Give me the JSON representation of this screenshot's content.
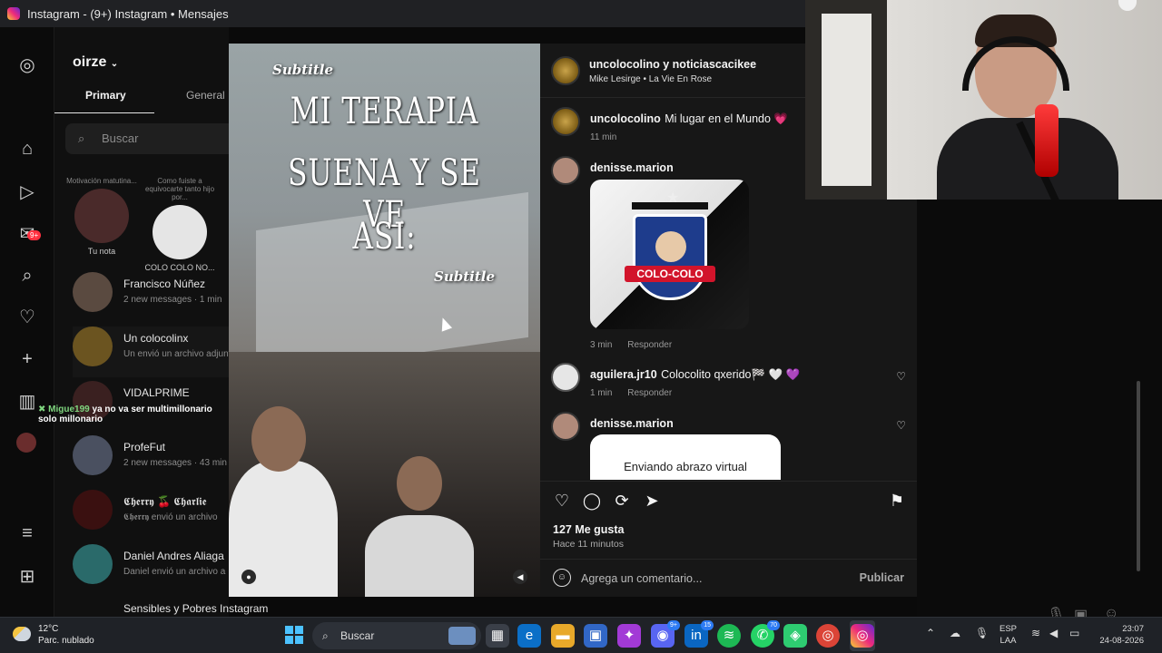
{
  "window": {
    "title": "Instagram - (9+) Instagram • Mensajes"
  },
  "rail": {
    "notification_badge": "9+"
  },
  "inbox": {
    "account": "oirze",
    "tabs": [
      "Primary",
      "General"
    ],
    "search_placeholder": "Buscar",
    "notes": [
      {
        "bubble": "Motivación matutina...",
        "name": "Tu nota"
      },
      {
        "bubble": "Como fuiste a equivocarte tanto hijo por...",
        "name": "COLO COLO NO..."
      }
    ],
    "chats": [
      {
        "name": "Francisco Núñez",
        "sub": "2 new messages · 1 min"
      },
      {
        "name": "Un colocolinx",
        "sub": "Un envió un archivo adjunto"
      },
      {
        "name": "VIDALPRIME",
        "sub": ""
      },
      {
        "name": "ProfeFut",
        "sub": "2 new messages · 43 min"
      },
      {
        "name": "𝕮𝖍𝖊𝖗𝖗𝖞 🍒 𝕮𝖍𝖆𝖗𝖑𝖎𝖊",
        "sub": "𝕮𝖍𝖊𝖗𝖗𝖞 envió un archivo"
      },
      {
        "name": "Daniel Andres Aliaga",
        "sub": "Daniel envió un archivo a"
      },
      {
        "name": "Sensibles y Pobres Instagram",
        "sub": ""
      }
    ]
  },
  "stream_chat": {
    "user": "Migue199",
    "message": "ya no va ser multimillonario solo millonario"
  },
  "video": {
    "subtitle_top": "Subtitle",
    "lines": [
      "MI TERAPIA",
      "SUENA Y SE VE",
      "ASI:"
    ],
    "subtitle_bottom": "Subtitle"
  },
  "post": {
    "author": "uncolocolino y noticiascacikee",
    "audio": "Mike Lesirge • La Vie En Rose",
    "caption_user": "uncolocolino",
    "caption_text": "Mi lugar en el Mundo 💗",
    "caption_time": "11 min",
    "comments": [
      {
        "user": "denisse.marion",
        "text": "",
        "time": "3 min",
        "reply": "Responder",
        "sticker": "COLO-COLO"
      },
      {
        "user": "aguilera.jr10",
        "text": "Colocolito qxerido🏁 🤍 💜",
        "time": "1 min",
        "reply": "Responder"
      },
      {
        "user": "denisse.marion",
        "text": "",
        "sticker_text": "Enviando abrazo virtual"
      }
    ],
    "likes": "127 Me gusta",
    "posted_ago": "Hace 11 minutos",
    "comment_placeholder": "Agrega un comentario...",
    "publish_label": "Publicar"
  },
  "taskbar": {
    "weather_temp": "12°C",
    "weather_desc": "Parc. nublado",
    "search_label": "Buscar",
    "badges": {
      "discord": "9+",
      "linkedin": "15",
      "whatsapp": "70"
    },
    "lang_top": "ESP",
    "lang_bottom": "LAA",
    "time": "23:07",
    "date": "24-08-2026"
  }
}
